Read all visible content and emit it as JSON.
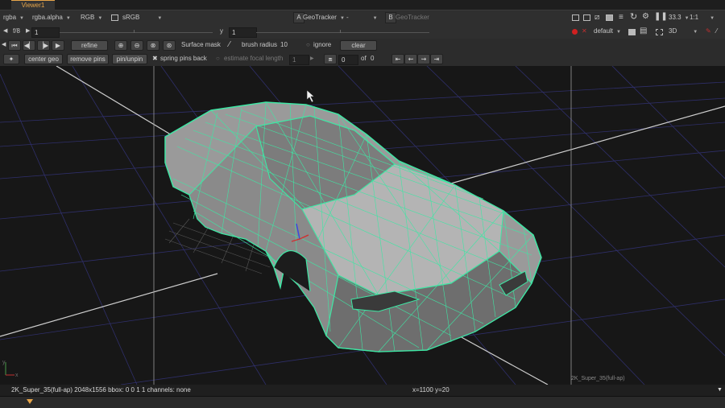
{
  "window": {
    "tab_label": "Viewer1"
  },
  "top_bar": {
    "channels": "rgba",
    "alpha_channel": "rgba.alpha",
    "display_channels": "RGB",
    "colorspace": "sRGB",
    "input_a_letter": "A",
    "input_a_node": "GeoTracker",
    "input_a_op": "-",
    "input_b_letter": "B",
    "input_b_node": "GeoTracker",
    "zoom": "33.3",
    "scale": "1:1"
  },
  "second_bar": {
    "fstop": "f/8",
    "frame": "1",
    "y_label": "y",
    "y_value": "1",
    "lut": "default",
    "view_mode": "3D"
  },
  "tracker_bar": {
    "refine": "refine",
    "surface_mask": "Surface mask",
    "brush_radius_label": "brush radius",
    "brush_radius_value": "10",
    "ignore": "ignore",
    "clear": "clear"
  },
  "pins_bar": {
    "center_geo": "center geo",
    "remove_pins": "remove pins",
    "pin_unpin": "pin/unpin",
    "spring_pins_back": "spring pins back",
    "estimate_focal_length": "estimate focal length",
    "focal_value": "1",
    "keyframe_current": "0",
    "of_label": "of",
    "keyframe_total": "0"
  },
  "viewport": {
    "format_label": "2K_Super_35(full-ap)",
    "axis_y": "y",
    "axis_x": "x",
    "wireframe_color": "#3fe6a4"
  },
  "status": {
    "format_info": "2K_Super_35(full-ap) 2048x1556  bbox: 0 0 1 1 channels: none",
    "coords": "x=1100 y=20"
  },
  "colors": {
    "accent_orange": "#e8a64a",
    "wire_green": "#3fe6a4",
    "grid_blue": "#2f2f6a"
  }
}
